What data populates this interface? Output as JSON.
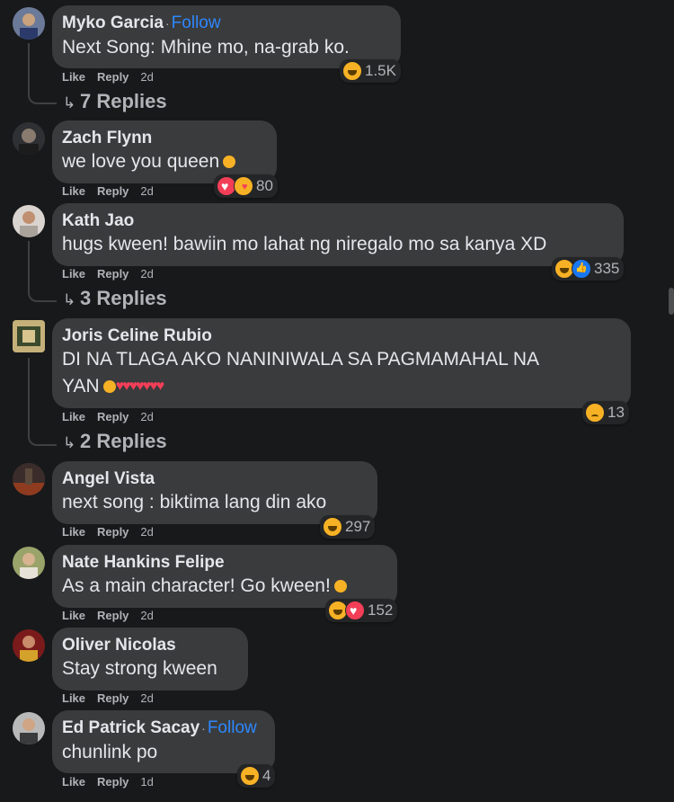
{
  "actions": {
    "like": "Like",
    "reply": "Reply"
  },
  "follow_label": "Follow",
  "separator": "·",
  "comments": [
    {
      "name": "Myko Garcia",
      "follow": true,
      "text": "Next Song: Mhine mo, na-grab ko.",
      "time": "2d",
      "reactions": [
        "haha"
      ],
      "count": "1.5K",
      "replies": "7 Replies"
    },
    {
      "name": "Zach Flynn",
      "follow": false,
      "text": "we love you queen",
      "time": "2d",
      "reactions": [
        "love",
        "care"
      ],
      "count": "80",
      "replies": null
    },
    {
      "name": "Kath Jao",
      "follow": false,
      "text": "hugs kween! bawiin mo lahat ng niregalo mo sa kanya XD",
      "time": "2d",
      "reactions": [
        "haha",
        "like"
      ],
      "count": "335",
      "replies": "3 Replies"
    },
    {
      "name": "Joris Celine Rubio",
      "follow": false,
      "text": "DI NA TLAGA AKO NANINIWALA SA PAGMAMAHAL NA",
      "text2": "YAN",
      "time": "2d",
      "reactions": [
        "sad"
      ],
      "count": "13",
      "replies": "2 Replies"
    },
    {
      "name": "Angel Vista",
      "follow": false,
      "text": "next song : biktima lang din ako",
      "time": "2d",
      "reactions": [
        "haha"
      ],
      "count": "297",
      "replies": null
    },
    {
      "name": "Nate Hankins Felipe",
      "follow": false,
      "text": "As a main character! Go kween!",
      "time": "2d",
      "reactions": [
        "haha",
        "love"
      ],
      "count": "152",
      "replies": null
    },
    {
      "name": "Oliver Nicolas",
      "follow": false,
      "text": "Stay strong kween",
      "time": "2d",
      "reactions": [],
      "count": null,
      "replies": null
    },
    {
      "name": "Ed Patrick Sacay",
      "follow": true,
      "text": "chunlink po",
      "time": "1d",
      "reactions": [
        "haha"
      ],
      "count": "4",
      "replies": null
    }
  ],
  "colors": {
    "background": "#18191a",
    "bubble": "#3a3b3c",
    "follow": "#2d88ff",
    "secondary_text": "#b0b3b8"
  }
}
